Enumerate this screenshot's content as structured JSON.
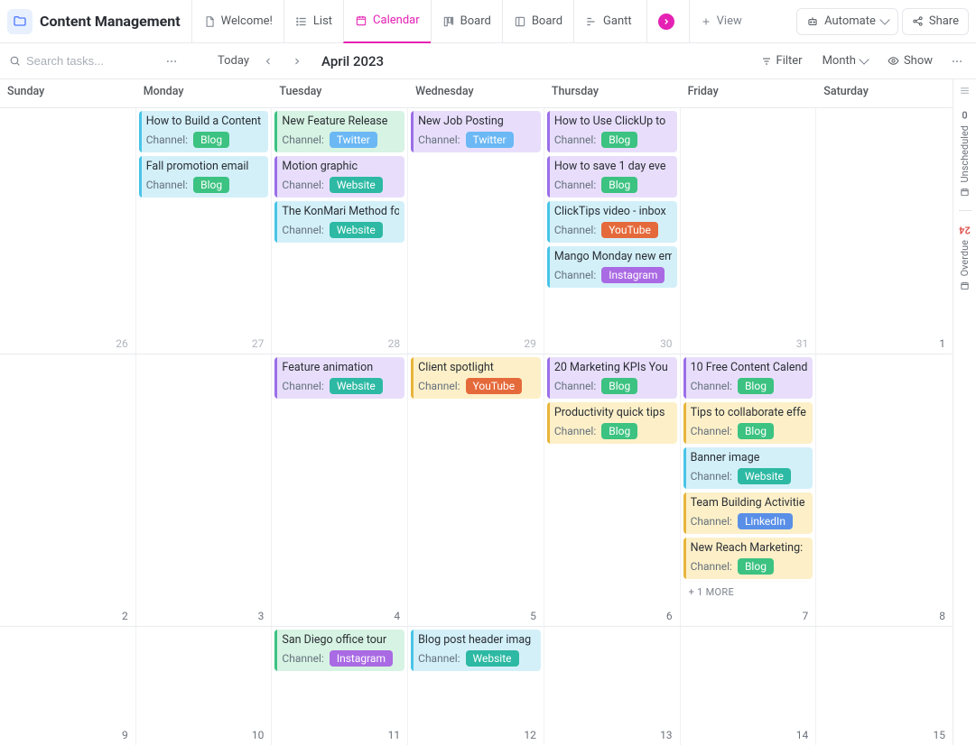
{
  "header": {
    "title": "Content Management",
    "tabs": [
      {
        "label": "Welcome!",
        "icon": "doc"
      },
      {
        "label": "List",
        "icon": "list"
      },
      {
        "label": "Calendar",
        "icon": "calendar",
        "active": true
      },
      {
        "label": "Board",
        "icon": "board"
      },
      {
        "label": "Board",
        "icon": "board2"
      },
      {
        "label": "Gantt",
        "icon": "gantt"
      }
    ],
    "add_view": "View",
    "automate": "Automate",
    "share": "Share"
  },
  "controls": {
    "search_placeholder": "Search tasks...",
    "today": "Today",
    "month_label": "April 2023",
    "filter": "Filter",
    "period": "Month",
    "show": "Show"
  },
  "day_headers": [
    "Sunday",
    "Monday",
    "Tuesday",
    "Wednesday",
    "Thursday",
    "Friday",
    "Saturday"
  ],
  "rail": {
    "unscheduled_label": "Unscheduled",
    "unscheduled_count": "0",
    "overdue_label": "Overdue",
    "overdue_count": "24"
  },
  "channel_tags": {
    "blog": "Blog",
    "twitter": "Twitter",
    "website": "Website",
    "youtube": "YouTube",
    "instagram": "Instagram",
    "linkedin": "LinkedIn"
  },
  "channel_label": "Channel:",
  "more_text": "+ 1 MORE",
  "weeks": [
    {
      "class": "h0",
      "days": [
        {
          "num": "26",
          "other": true,
          "events": []
        },
        {
          "num": "27",
          "other": true,
          "events": [
            {
              "title": "How to Build a Content",
              "bg": "blue",
              "channel": "blog"
            },
            {
              "title": "Fall promotion email",
              "bg": "blue",
              "channel": "blog"
            }
          ]
        },
        {
          "num": "28",
          "other": true,
          "events": [
            {
              "title": "New Feature Release",
              "bg": "green",
              "channel": "twitter"
            },
            {
              "title": "Motion graphic",
              "bg": "purple",
              "channel": "website"
            },
            {
              "title": "The KonMari Method fo",
              "bg": "blue",
              "channel": "website"
            }
          ]
        },
        {
          "num": "29",
          "other": true,
          "events": [
            {
              "title": "New Job Posting",
              "bg": "purple",
              "channel": "twitter"
            }
          ]
        },
        {
          "num": "30",
          "other": true,
          "events": [
            {
              "title": "How to Use ClickUp to",
              "bg": "purple",
              "channel": "blog"
            },
            {
              "title": "How to save 1 day eve",
              "bg": "purple",
              "channel": "blog"
            },
            {
              "title": "ClickTips video - inbox",
              "bg": "blue",
              "channel": "youtube"
            },
            {
              "title": "Mango Monday new em",
              "bg": "blue",
              "channel": "instagram"
            }
          ]
        },
        {
          "num": "31",
          "other": true,
          "events": []
        },
        {
          "num": "1",
          "events": []
        }
      ]
    },
    {
      "class": "h1",
      "days": [
        {
          "num": "2",
          "events": []
        },
        {
          "num": "3",
          "events": []
        },
        {
          "num": "4",
          "events": [
            {
              "title": "Feature animation",
              "bg": "purple",
              "channel": "website"
            }
          ]
        },
        {
          "num": "5",
          "events": [
            {
              "title": "Client spotlight",
              "bg": "yellow",
              "channel": "youtube"
            }
          ]
        },
        {
          "num": "6",
          "events": [
            {
              "title": "20 Marketing KPIs You",
              "bg": "purple",
              "channel": "blog"
            },
            {
              "title": "Productivity quick tips",
              "bg": "yellow",
              "channel": "blog"
            }
          ]
        },
        {
          "num": "7",
          "events": [
            {
              "title": "10 Free Content Calend",
              "bg": "purple",
              "channel": "blog"
            },
            {
              "title": "Tips to collaborate effe",
              "bg": "yellow",
              "channel": "blog"
            },
            {
              "title": "Banner image",
              "bg": "blue",
              "channel": "website"
            },
            {
              "title": "Team Building Activitie",
              "bg": "yellow",
              "channel": "linkedin"
            },
            {
              "title": "New Reach Marketing:",
              "bg": "yellow",
              "channel": "blog"
            }
          ],
          "more": true
        },
        {
          "num": "8",
          "events": []
        }
      ]
    },
    {
      "class": "h2",
      "days": [
        {
          "num": "9",
          "events": []
        },
        {
          "num": "10",
          "events": []
        },
        {
          "num": "11",
          "events": [
            {
              "title": "San Diego office tour",
              "bg": "green",
              "channel": "instagram"
            }
          ]
        },
        {
          "num": "12",
          "events": [
            {
              "title": "Blog post header imag",
              "bg": "blue",
              "channel": "website"
            }
          ]
        },
        {
          "num": "13",
          "events": []
        },
        {
          "num": "14",
          "events": []
        },
        {
          "num": "15",
          "events": []
        }
      ]
    }
  ]
}
